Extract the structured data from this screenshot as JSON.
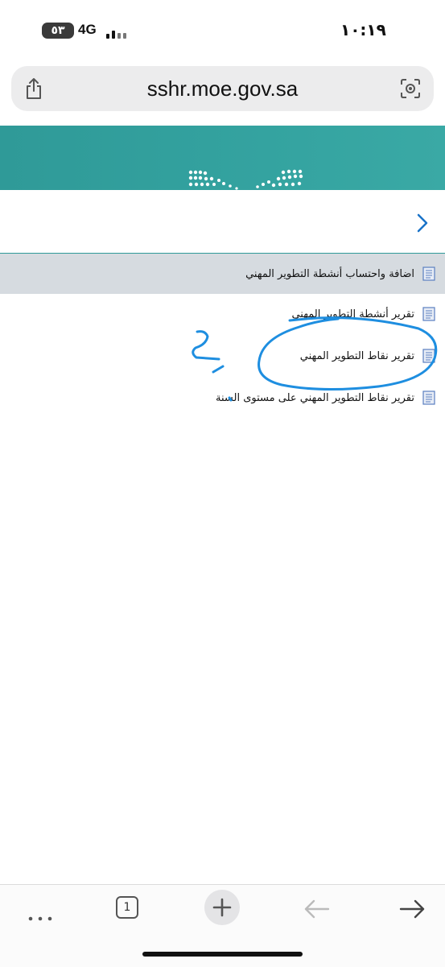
{
  "status": {
    "carrier_badge": "٥٣",
    "network": "4G",
    "time": "١٠:١٩"
  },
  "browser": {
    "url": "sshr.moe.gov.sa",
    "tab_count": "1"
  },
  "menu": {
    "items": [
      {
        "label": "اضافة واحتساب أنشطة التطوير المهني",
        "selected": true
      },
      {
        "label": "تقرير أنشطة التطوير المهني",
        "selected": false
      },
      {
        "label": "تقرير نقاط التطوير المهني",
        "selected": false
      },
      {
        "label": "تقرير نقاط التطوير المهني على مستوى السنة",
        "selected": false
      }
    ]
  },
  "colors": {
    "banner": "#2f9a98",
    "selected_row": "#d6dbe0",
    "link_blue": "#1a73c8",
    "annotation_ink": "#1e8ee0"
  },
  "icons": [
    "share-icon",
    "lens-icon",
    "chevron-right-icon",
    "document-icon",
    "more-icon",
    "plus-icon",
    "back-arrow-icon",
    "forward-arrow-icon"
  ]
}
